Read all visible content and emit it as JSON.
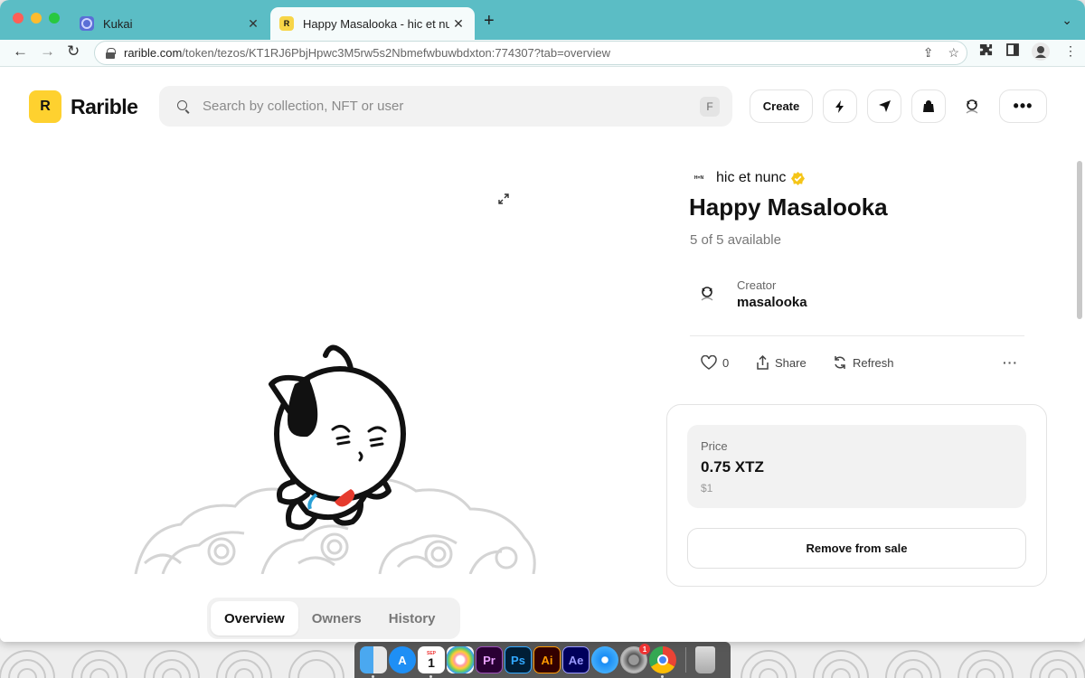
{
  "browser": {
    "tabs": [
      {
        "title": "Kukai",
        "favicon": "kukai-icon"
      },
      {
        "title": "Happy Masalooka - hic et nunc",
        "favicon": "rarible-icon"
      }
    ],
    "url_host": "rarible.com",
    "url_path": "/token/tezos/KT1RJ6PbjHpwc3M5rw5s2Nbmefwbuwbdxton:774307?tab=overview"
  },
  "header": {
    "brand": "Rarible",
    "brand_mark": "R",
    "search_placeholder": "Search by collection, NFT or user",
    "search_shortcut": "F",
    "create_label": "Create"
  },
  "nft": {
    "collection": "hic et nunc",
    "collection_logo_text": "H=N",
    "title": "Happy Masalooka",
    "availability": "5 of 5 available",
    "creator_label": "Creator",
    "creator_name": "masalooka",
    "likes": "0",
    "share_label": "Share",
    "refresh_label": "Refresh",
    "price_label": "Price",
    "price": "0.75 XTZ",
    "price_usd": "$1",
    "remove_label": "Remove from sale"
  },
  "content_tabs": [
    "Overview",
    "Owners",
    "History"
  ],
  "dock": {
    "apps": [
      "finder-icon",
      "app-store-icon",
      "calendar-icon",
      "photos-icon",
      "premiere-icon",
      "photoshop-icon",
      "illustrator-icon",
      "after-effects-icon",
      "safari-icon",
      "system-preferences-icon",
      "chrome-icon",
      "trash-icon"
    ],
    "calendar_day": "1",
    "calendar_month": "SEP",
    "premiere_label": "Pr",
    "photoshop_label": "Ps",
    "illustrator_label": "Ai",
    "after_effects_label": "Ae",
    "settings_badge": "1"
  },
  "colors": {
    "tabbar": "#5bbdc5",
    "brand_yellow": "#fed12f",
    "verified_badge": "#f5c518"
  }
}
